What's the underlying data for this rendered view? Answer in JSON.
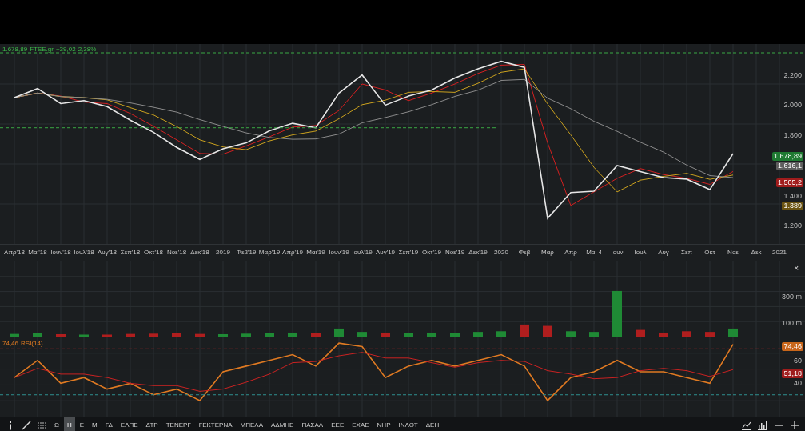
{
  "legend": {
    "price": "1.678,89",
    "change": "+39,02",
    "change_pct": "2,38%"
  },
  "price_chart": {
    "chart_data": {
      "type": "line",
      "grid": true,
      "categories": [
        "Απρ'18",
        "Μαι'18",
        "Ιουν'18",
        "Ιουλ'18",
        "Αυγ'18",
        "Σεπ'18",
        "Οκτ'18",
        "Νοε'18",
        "Δεκ'18",
        "2019",
        "Φεβ'19",
        "Μαρ'19",
        "Απρ'19",
        "Μαι'19",
        "Ιουν'19",
        "Ιουλ'19",
        "Αυγ'19",
        "Σεπ'19",
        "Οκτ'19",
        "Νοε'19",
        "Δεκ'19",
        "2020",
        "Φεβ",
        "Μαρ",
        "Απρ",
        "Μαι 4",
        "Ιουν",
        "Ιουλ",
        "Αυγ",
        "Σεπ",
        "Οκτ",
        "Νοε",
        "Δεκ",
        "2021"
      ],
      "series": [
        {
          "name": "FTSE.gr",
          "color": "#e6e6e6",
          "values": [
            2050,
            2110,
            2010,
            2030,
            1990,
            1900,
            1820,
            1720,
            1640,
            1710,
            1750,
            1830,
            1880,
            1850,
            2080,
            2200,
            2000,
            2060,
            2100,
            2180,
            2240,
            2290,
            2250,
            1250,
            1420,
            1430,
            1600,
            1560,
            1520,
            1510,
            1440,
            1679,
            null,
            null
          ]
        },
        {
          "color": "#8a8a8a",
          "values": [
            2050,
            2080,
            2057,
            2050,
            2038,
            2015,
            1986,
            1954,
            1904,
            1859,
            1816,
            1786,
            1774,
            1776,
            1808,
            1883,
            1918,
            1956,
            2003,
            2058,
            2099,
            2164,
            2170,
            2046,
            1976,
            1893,
            1826,
            1754,
            1689,
            1603,
            1533,
            1520,
            null,
            null
          ]
        },
        {
          "color": "#c9a01e",
          "values": [
            2050,
            2080,
            2057,
            2050,
            2035,
            1983,
            1935,
            1858,
            1770,
            1723,
            1705,
            1763,
            1803,
            1828,
            1910,
            2003,
            2033,
            2085,
            2090,
            2085,
            2145,
            2218,
            2240,
            2008,
            1803,
            1588,
            1425,
            1503,
            1528,
            1548,
            1508,
            1537,
            null,
            null
          ]
        },
        {
          "color": "#d42020",
          "values": [
            2050,
            2080,
            2060,
            2020,
            2010,
            1945,
            1860,
            1770,
            1680,
            1675,
            1730,
            1790,
            1855,
            1865,
            1965,
            2140,
            2100,
            2030,
            2080,
            2140,
            2210,
            2265,
            2270,
            1750,
            1335,
            1425,
            1515,
            1580,
            1540,
            1515,
            1475,
            1560,
            null,
            null
          ]
        }
      ],
      "ylim": [
        1080,
        2405
      ],
      "yticks": [
        {
          "value": 1200,
          "label": "1.200"
        },
        {
          "value": 1400,
          "label": "1.400"
        },
        {
          "value": 1800,
          "label": "1.800"
        },
        {
          "value": 2000,
          "label": "2.000"
        },
        {
          "value": 2200,
          "label": "2.200"
        }
      ]
    },
    "badges": [
      {
        "text": "1.678,89",
        "color": "#1f7a32"
      },
      {
        "text": "1.616,1",
        "color": "#5e5e5e"
      },
      {
        "text": "1.505,2",
        "color": "#a01c1c"
      },
      {
        "text": "1.389",
        "color": "#6b5412"
      }
    ]
  },
  "volume_chart": {
    "close": "×",
    "chart_data": {
      "type": "bar",
      "grid": true,
      "values": [
        20,
        25,
        18,
        15,
        15,
        20,
        22,
        25,
        20,
        18,
        22,
        25,
        30,
        25,
        60,
        35,
        30,
        28,
        30,
        28,
        35,
        40,
        90,
        80,
        40,
        35,
        340,
        50,
        30,
        40,
        35,
        60,
        null,
        null
      ],
      "ylim": [
        0,
        560
      ],
      "yticks": [
        {
          "value": 100,
          "label": "100 m"
        },
        {
          "value": 300,
          "label": "300 m"
        }
      ]
    }
  },
  "rsi_chart": {
    "value": "74,46",
    "label": "RSI(14)",
    "chart_data": {
      "type": "line",
      "grid": true,
      "series": [
        {
          "color": "#c92222",
          "values": [
            45,
            53,
            48,
            48,
            45,
            40,
            38,
            38,
            33,
            35,
            41,
            48,
            58,
            59,
            64,
            67,
            62,
            62,
            58,
            54,
            58,
            60,
            59,
            51,
            48,
            44,
            45,
            51,
            53,
            51,
            46,
            52,
            null,
            null
          ]
        },
        {
          "color": "#e07a22",
          "values": [
            45,
            60,
            40,
            45,
            35,
            40,
            30,
            35,
            25,
            50,
            55,
            60,
            65,
            55,
            75,
            72,
            45,
            55,
            60,
            55,
            60,
            65,
            55,
            25,
            45,
            50,
            60,
            50,
            50,
            45,
            40,
            74,
            null,
            null
          ]
        }
      ],
      "ylim": [
        11,
        80
      ],
      "yticks": [
        {
          "value": 40,
          "label": "40"
        },
        {
          "value": 60,
          "label": "60"
        }
      ]
    },
    "badges": [
      {
        "text": "74,46",
        "color": "#c8661a"
      },
      {
        "text": "51,18",
        "color": "#9e1c1c"
      }
    ]
  },
  "toolbar": {
    "items": [
      {
        "label": "Ω",
        "selected": false
      },
      {
        "label": "Η",
        "selected": true
      },
      {
        "label": "Ε",
        "selected": false
      },
      {
        "label": "Μ",
        "selected": false
      },
      {
        "label": "ΓΔ",
        "selected": false
      },
      {
        "label": "ΕΛΠΕ",
        "selected": false
      },
      {
        "label": "ΔΤΡ",
        "selected": false
      },
      {
        "label": "ΤΕΝΕΡΓ",
        "selected": false
      },
      {
        "label": "ΓΕΚΤΕΡΝΑ",
        "selected": false
      },
      {
        "label": "ΜΠΕΛΑ",
        "selected": false
      },
      {
        "label": "ΑΔΜΗΕ",
        "selected": false
      },
      {
        "label": "ΠΑΣΑΛ",
        "selected": false
      },
      {
        "label": "ΕΕΕ",
        "selected": false
      },
      {
        "label": "ΕΧΑΕ",
        "selected": false
      },
      {
        "label": "ΝΗΡ",
        "selected": false
      },
      {
        "label": "ΙΝΛΟΤ",
        "selected": false
      },
      {
        "label": "ΔΕΗ",
        "selected": false
      }
    ]
  }
}
